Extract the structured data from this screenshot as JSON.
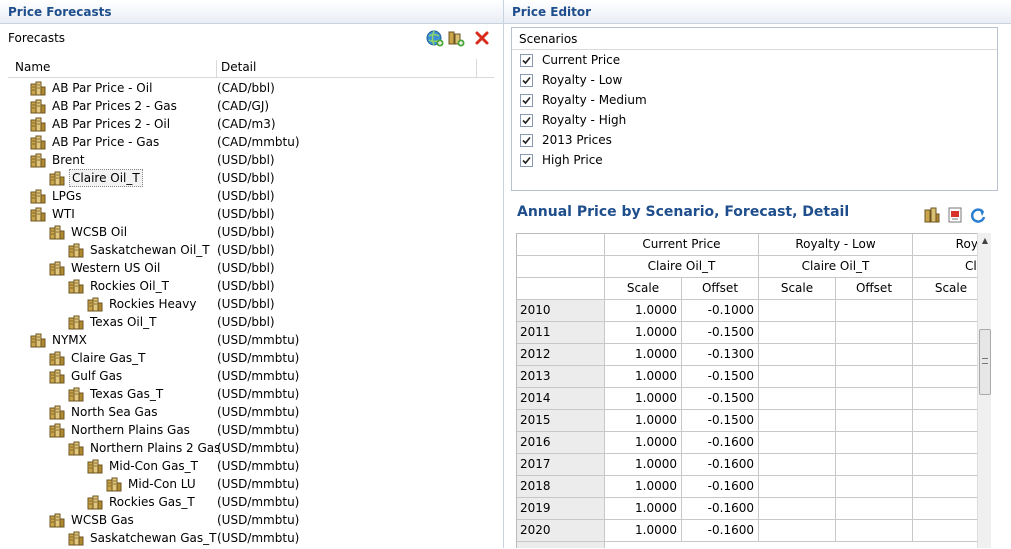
{
  "price_forecasts": {
    "title": "Price Forecasts",
    "forecasts_label": "Forecasts",
    "columns": {
      "name": "Name",
      "detail": "Detail"
    },
    "tree": [
      {
        "label": "AB Par Price - Oil",
        "detail": "(CAD/bbl)",
        "level": 1
      },
      {
        "label": "AB Par Prices 2 - Gas",
        "detail": "(CAD/GJ)",
        "level": 1
      },
      {
        "label": "AB Par Prices 2 - Oil",
        "detail": "(CAD/m3)",
        "level": 1
      },
      {
        "label": "AB Par Price - Gas",
        "detail": "(CAD/mmbtu)",
        "level": 1
      },
      {
        "label": "Brent",
        "detail": "(USD/bbl)",
        "level": 1
      },
      {
        "label": "Claire Oil_T",
        "detail": "(USD/bbl)",
        "level": 2,
        "selected": true
      },
      {
        "label": "LPGs",
        "detail": "(USD/bbl)",
        "level": 1
      },
      {
        "label": "WTI",
        "detail": "(USD/bbl)",
        "level": 1
      },
      {
        "label": "WCSB Oil",
        "detail": "(USD/bbl)",
        "level": 2
      },
      {
        "label": "Saskatchewan Oil_T",
        "detail": "(USD/bbl)",
        "level": 3
      },
      {
        "label": "Western US Oil",
        "detail": "(USD/bbl)",
        "level": 2
      },
      {
        "label": "Rockies Oil_T",
        "detail": "(USD/bbl)",
        "level": 3
      },
      {
        "label": "Rockies Heavy",
        "detail": "(USD/bbl)",
        "level": 4
      },
      {
        "label": "Texas Oil_T",
        "detail": "(USD/bbl)",
        "level": 3
      },
      {
        "label": "NYMX",
        "detail": "(USD/mmbtu)",
        "level": 1
      },
      {
        "label": "Claire Gas_T",
        "detail": "(USD/mmbtu)",
        "level": 2
      },
      {
        "label": "Gulf Gas",
        "detail": "(USD/mmbtu)",
        "level": 2
      },
      {
        "label": "Texas Gas_T",
        "detail": "(USD/mmbtu)",
        "level": 3
      },
      {
        "label": "North Sea Gas",
        "detail": "(USD/mmbtu)",
        "level": 2
      },
      {
        "label": "Northern Plains Gas",
        "detail": "(USD/mmbtu)",
        "level": 2
      },
      {
        "label": "Northern Plains 2 Gas",
        "detail": "(USD/mmbtu)",
        "level": 3
      },
      {
        "label": "Mid-Con Gas_T",
        "detail": "(USD/mmbtu)",
        "level": 4
      },
      {
        "label": "Mid-Con LU",
        "detail": "(USD/mmbtu)",
        "level": 5
      },
      {
        "label": "Rockies Gas_T",
        "detail": "(USD/mmbtu)",
        "level": 4
      },
      {
        "label": "WCSB Gas",
        "detail": "(USD/mmbtu)",
        "level": 2
      },
      {
        "label": "Saskatchewan Gas_T",
        "detail": "(USD/mmbtu)",
        "level": 3
      }
    ],
    "toolbar_icons": [
      "globe-add-icon",
      "forecast-add-icon",
      "delete-icon"
    ]
  },
  "price_editor": {
    "title": "Price Editor",
    "scenarios_header": "Scenarios",
    "scenarios": [
      {
        "label": "Current Price",
        "checked": true
      },
      {
        "label": "Royalty - Low",
        "checked": true
      },
      {
        "label": "Royalty - Medium",
        "checked": true
      },
      {
        "label": "Royalty - High",
        "checked": true
      },
      {
        "label": "2013 Prices",
        "checked": true
      },
      {
        "label": "High Price",
        "checked": true
      }
    ],
    "annual_title": "Annual Price by Scenario, Forecast, Detail",
    "annual_icons": [
      "forecast-icon",
      "export-icon",
      "refresh-icon"
    ],
    "grid": {
      "scenarios": [
        "Current Price",
        "Royalty - Low",
        "Royalt"
      ],
      "forecasts": [
        "Claire Oil_T",
        "Claire Oil_T",
        "Cla"
      ],
      "subcols": [
        "Scale",
        "Offset",
        "Scale",
        "Offset",
        "Scale"
      ],
      "rows": [
        {
          "year": "2010",
          "scale": "1.0000",
          "offset": "-0.1000"
        },
        {
          "year": "2011",
          "scale": "1.0000",
          "offset": "-0.1500"
        },
        {
          "year": "2012",
          "scale": "1.0000",
          "offset": "-0.1300"
        },
        {
          "year": "2013",
          "scale": "1.0000",
          "offset": "-0.1500"
        },
        {
          "year": "2014",
          "scale": "1.0000",
          "offset": "-0.1500"
        },
        {
          "year": "2015",
          "scale": "1.0000",
          "offset": "-0.1500"
        },
        {
          "year": "2016",
          "scale": "1.0000",
          "offset": "-0.1600"
        },
        {
          "year": "2017",
          "scale": "1.0000",
          "offset": "-0.1600"
        },
        {
          "year": "2018",
          "scale": "1.0000",
          "offset": "-0.1600"
        },
        {
          "year": "2019",
          "scale": "1.0000",
          "offset": "-0.1600"
        },
        {
          "year": "2020",
          "scale": "1.0000",
          "offset": "-0.1600"
        }
      ]
    }
  }
}
